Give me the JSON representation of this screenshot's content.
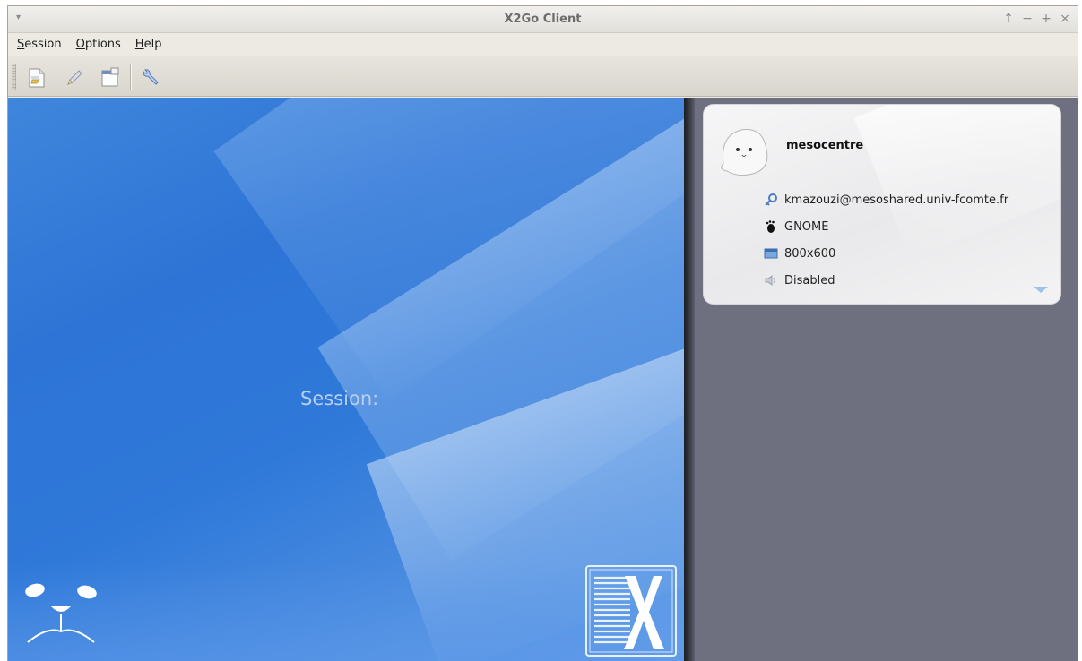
{
  "window": {
    "title": "X2Go Client",
    "wm_menu_glyph": "▾",
    "wm_buttons": [
      "↑",
      "−",
      "+",
      "×"
    ]
  },
  "menubar": {
    "items": [
      {
        "mnemonic": "S",
        "rest": "ession"
      },
      {
        "mnemonic": "O",
        "rest": "ptions"
      },
      {
        "mnemonic": "H",
        "rest": "elp"
      }
    ]
  },
  "toolbar": {
    "buttons": [
      {
        "icon": "new-session-icon"
      },
      {
        "icon": "edit-session-icon"
      },
      {
        "icon": "session-management-icon"
      },
      {
        "icon": "settings-wrench-icon"
      }
    ]
  },
  "login": {
    "session_label": "Session:"
  },
  "session_card": {
    "name": "mesocentre",
    "server": "kmazouzi@mesoshared.univ-fcomte.fr",
    "desktop": "GNOME",
    "geometry": "800x600",
    "sound": "Disabled"
  },
  "colors": {
    "left_panel": "#2f79d9",
    "right_panel": "#6e7080",
    "card_bg": "#ededef"
  }
}
